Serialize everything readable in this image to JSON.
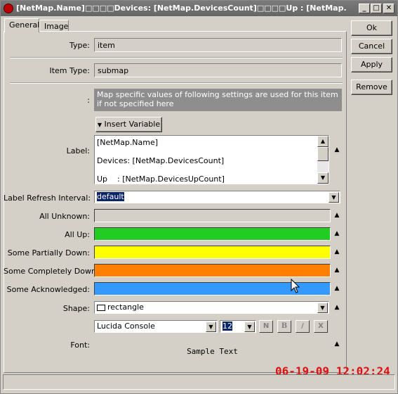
{
  "window": {
    "title": "[NetMap.Name]□□□□Devices: [NetMap.DevicesCount]□□□□Up    : [NetMap.Devi...",
    "controls": {
      "minimize": "_",
      "maximize": "□",
      "close": "✕"
    }
  },
  "tabs": [
    {
      "label": "General"
    },
    {
      "label": "Image"
    }
  ],
  "buttons": {
    "ok": "Ok",
    "cancel": "Cancel",
    "apply": "Apply",
    "remove": "Remove"
  },
  "form": {
    "type": {
      "label": "Type:",
      "value": "item"
    },
    "item_type": {
      "label": "Item Type:",
      "value": "submap"
    },
    "note_prefix": ":",
    "note": "Map specific values of following settings are used for this item if not specified here",
    "insert_variable": "Insert Variable",
    "label": {
      "label": "Label:",
      "lines": [
        "[NetMap.Name]",
        "Devices: [NetMap.DevicesCount]",
        "Up    : [NetMap.DevicesUpCount]"
      ]
    },
    "label_refresh": {
      "label": "Label Refresh Interval:",
      "value": "default"
    },
    "colors": [
      {
        "label": "All Unknown:",
        "color": "#d4d0c8"
      },
      {
        "label": "All Up:",
        "color": "#22cc22"
      },
      {
        "label": "Some Partially Down:",
        "color": "#ffff00"
      },
      {
        "label": "Some Completely Down:",
        "color": "#ff8000"
      },
      {
        "label": "Some Acknowledged:",
        "color": "#3399ff"
      }
    ],
    "shape": {
      "label": "Shape:",
      "value": "rectangle"
    },
    "font": {
      "label": "Font:",
      "family": "Lucida Console",
      "size": "12",
      "style_buttons": [
        "N",
        "B",
        "/",
        "X"
      ],
      "sample": "Sample Text"
    }
  },
  "timestamp": "06-19-09 12:02:24"
}
